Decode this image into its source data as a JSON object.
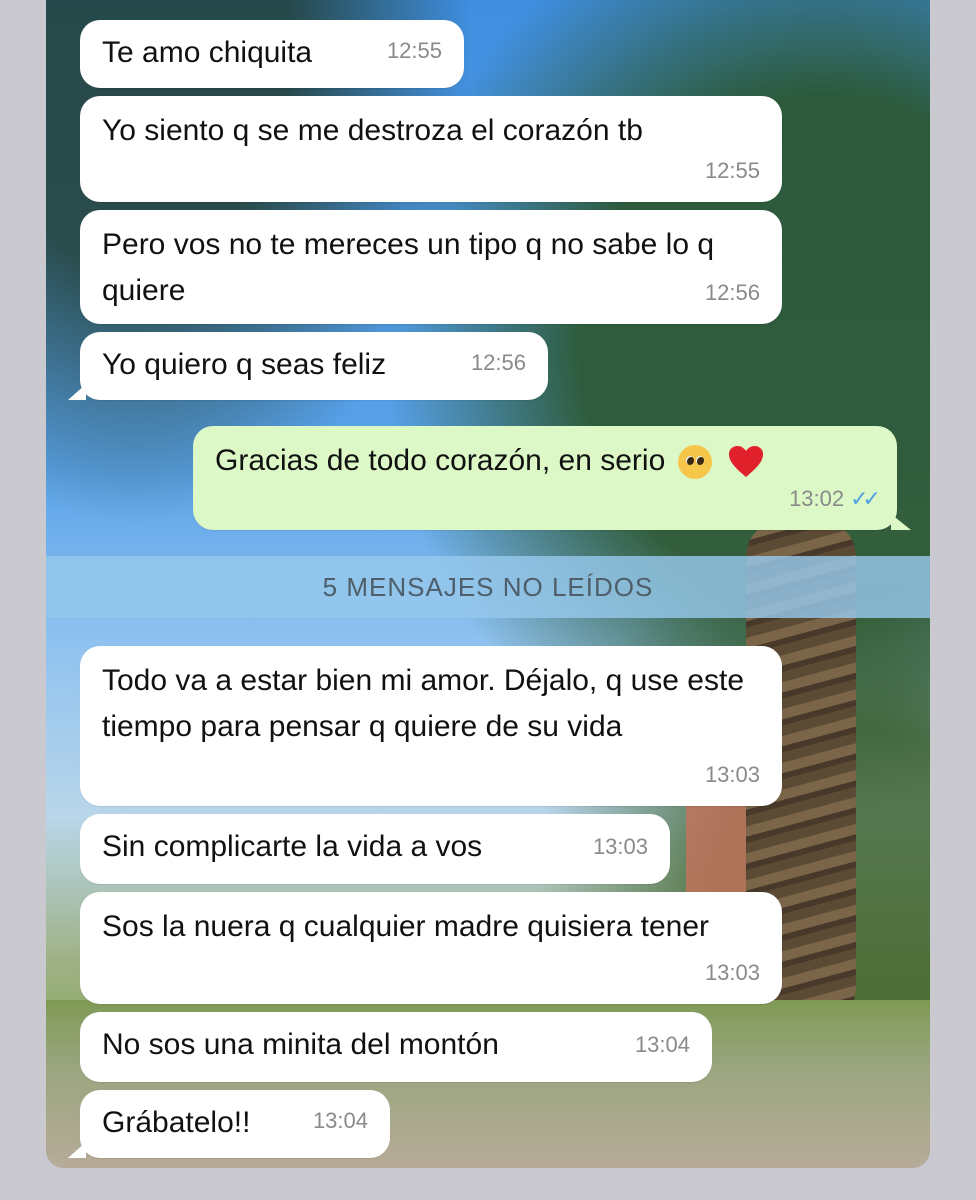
{
  "conversation": {
    "unread_banner": "5 MENSAJES NO LEÍDOS",
    "messages": [
      {
        "text": "Te amo chiquita",
        "time": "12:55",
        "direction": "in"
      },
      {
        "text": "Yo siento q se me destroza el corazón tb",
        "time": "12:55",
        "direction": "in"
      },
      {
        "text": "Pero vos no te mereces un tipo q no sabe lo q quiere",
        "time": "12:56",
        "direction": "in"
      },
      {
        "text": "Yo quiero q seas feliz",
        "time": "12:56",
        "direction": "in"
      },
      {
        "text": "Gracias de todo corazón, en serio",
        "time": "13:02",
        "direction": "out",
        "status": "read",
        "emojis": [
          "pleading-face",
          "red-heart"
        ]
      },
      {
        "text": "Todo va a estar bien mi amor. Déjalo, q use este tiempo para pensar q quiere de su vida",
        "time": "13:03",
        "direction": "in"
      },
      {
        "text": "Sin complicarte la vida a vos",
        "time": "13:03",
        "direction": "in"
      },
      {
        "text": "Sos la nuera q cualquier madre quisiera tener",
        "time": "13:03",
        "direction": "in"
      },
      {
        "text": "No sos una minita del montón",
        "time": "13:04",
        "direction": "in"
      },
      {
        "text": "Grábatelo!!",
        "time": "13:04",
        "direction": "in"
      }
    ]
  },
  "colors": {
    "incoming_bubble": "#ffffff",
    "outgoing_bubble": "#dcf8c6",
    "read_ticks": "#4fa3e0",
    "timestamp": "#8a8a8a"
  }
}
